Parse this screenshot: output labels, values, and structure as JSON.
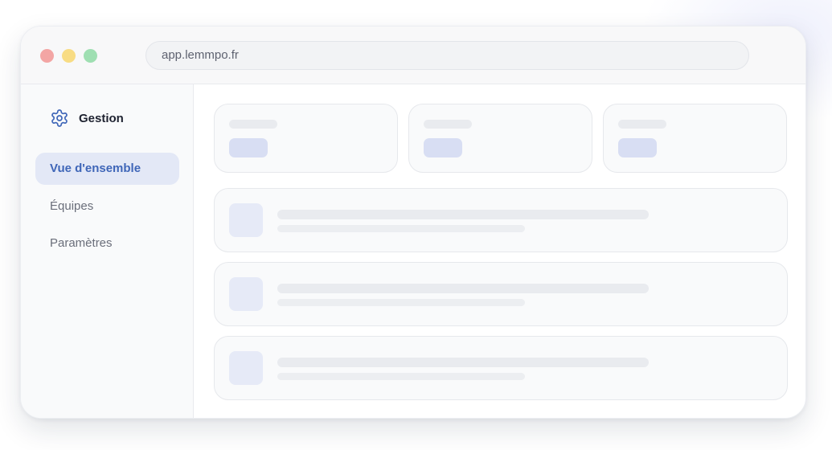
{
  "browser": {
    "url": "app.lemmpo.fr",
    "traffic_lights": {
      "close": "#f3a5a4",
      "minimize": "#f8dc84",
      "maximize": "#9fdfb2"
    }
  },
  "sidebar": {
    "brand_icon": "gear-icon",
    "brand": "Gestion",
    "items": [
      {
        "label": "Vue d'ensemble",
        "active": true
      },
      {
        "label": "Équipes",
        "active": false
      },
      {
        "label": "Paramètres",
        "active": false
      }
    ]
  },
  "colors": {
    "accent": "#3f66b8",
    "active_background": "#e3e8f6"
  },
  "main": {
    "stat_card_count": 3,
    "row_card_count": 3,
    "loading": true
  }
}
